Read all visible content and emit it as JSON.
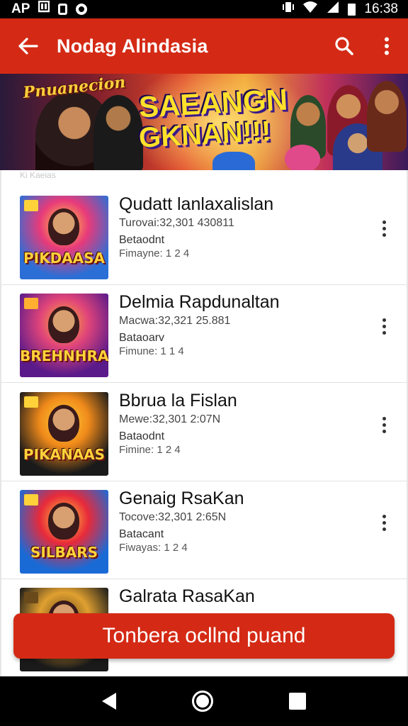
{
  "status_bar": {
    "left_text": "AP",
    "time": "16:38",
    "icons": [
      "notification-icon",
      "sim-icon",
      "sync-icon",
      "vibrate-icon",
      "wifi-icon",
      "signal-icon",
      "battery-icon"
    ]
  },
  "app_bar": {
    "title": "Nodag Alindasia",
    "icons": [
      "back-arrow-icon",
      "search-icon",
      "more-vert-icon"
    ],
    "background": "#d42a15"
  },
  "banner": {
    "logo_text": "Pnuanecion",
    "headline_1": "SAEANGN",
    "headline_2": "GKNAN!!!",
    "accent": "#ffe02a"
  },
  "list": {
    "header_text": "Ki Kaeias",
    "items": [
      {
        "title": "Qudatt lanlaxalislan",
        "meta": "Turovai:32,301 430811",
        "line3": "Betaodnt",
        "line4": "Fimayne: 1 2 4",
        "thumb_title": "PIKDAASA",
        "thumb_colors": [
          "#2b6fd6",
          "#e83a7a",
          "#ffd23a"
        ]
      },
      {
        "title": "Delmia Rapdunaltan",
        "meta": "Macwa:32,321 25.881",
        "line3": "Bataoarv",
        "line4": "Fimune: 1 1 4",
        "thumb_title": "BREHNHRA",
        "thumb_colors": [
          "#5a1a8a",
          "#e0447a",
          "#ffb030"
        ]
      },
      {
        "title": "Bbrua la Fislan",
        "meta": "Mewe:32,301 2:07N",
        "line3": "Bataodnt",
        "line4": "Fimine: 1 2 4",
        "thumb_title": "PIKANAAS",
        "thumb_colors": [
          "#1a1a1a",
          "#f08a1a",
          "#ffd23a"
        ]
      },
      {
        "title": "Genaig RsaKan",
        "meta": "Tocove:32,301 2:65N",
        "line3": "Batacant",
        "line4": "Fiwayas: 1 2 4",
        "thumb_title": "SILBARS",
        "thumb_colors": [
          "#1a6ad6",
          "#e82a3a",
          "#ffd23a"
        ]
      },
      {
        "title": "Galrata RasaKan",
        "meta": "",
        "line3": "",
        "line4": "",
        "thumb_title": "",
        "thumb_colors": [
          "#1a1a1a",
          "#e0a030",
          "#6a4a1a"
        ]
      }
    ]
  },
  "cta": {
    "label": "Tonbera ocllnd puand",
    "background": "#d42a15"
  },
  "nav_bar": {
    "icons": [
      "nav-back-icon",
      "nav-home-icon",
      "nav-recents-icon"
    ]
  }
}
